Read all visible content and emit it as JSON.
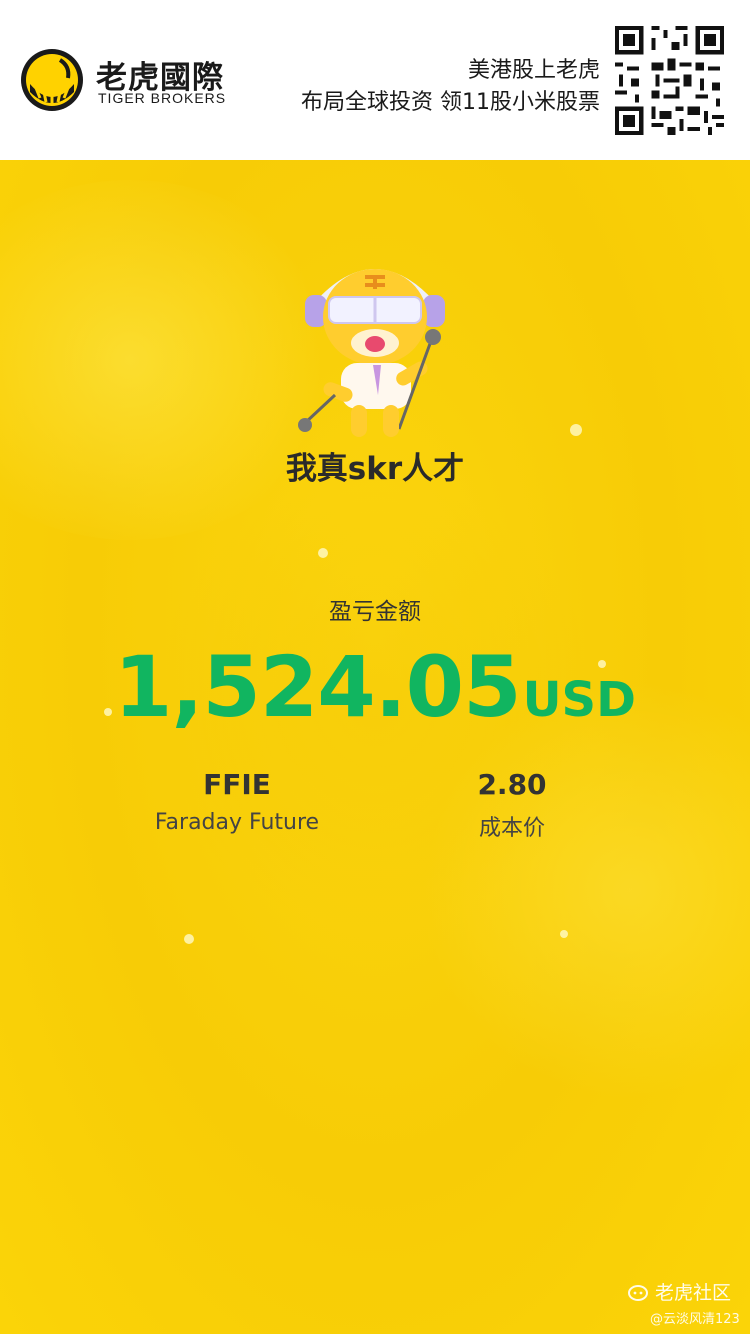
{
  "header": {
    "logo_cn": "老虎國際",
    "logo_en": "TIGER BROKERS",
    "promo_line1": "美港股上老虎",
    "promo_line2": "布局全球投资 领11股小米股票",
    "logo_icon": "tiger-logo-icon",
    "qr_icon": "qr-code-icon"
  },
  "card": {
    "slogan": "我真skr人才",
    "pl_label": "盈亏金额",
    "amount": "1,524.05",
    "currency": "USD",
    "ticker": "FFIE",
    "company": "Faraday Future",
    "cost_value": "2.80",
    "cost_label": "成本价",
    "mascot_icon": "tiger-mascot-icon"
  },
  "watermark": {
    "community": "老虎社区",
    "user": "@云淡风清123"
  },
  "colors": {
    "gain_green": "#11b560",
    "poster_yellow": "#f9cf08",
    "brand_yellow": "#ffd200"
  }
}
